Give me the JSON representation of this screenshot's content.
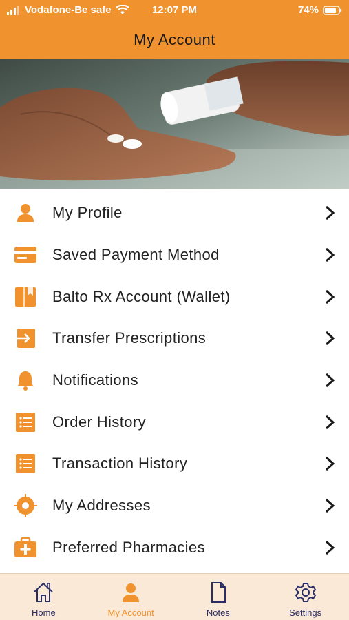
{
  "status": {
    "carrier": "Vodafone-Be safe",
    "time": "12:07 PM",
    "battery": "74%"
  },
  "header": {
    "title": "My Account"
  },
  "menu": {
    "items": [
      {
        "label": "My Profile",
        "icon": "user-icon"
      },
      {
        "label": "Saved Payment Method",
        "icon": "credit-card-icon"
      },
      {
        "label": "Balto Rx Account (Wallet)",
        "icon": "wallet-book-icon"
      },
      {
        "label": "Transfer Prescriptions",
        "icon": "transfer-arrow-icon"
      },
      {
        "label": "Notifications",
        "icon": "bell-icon"
      },
      {
        "label": "Order History",
        "icon": "list-icon"
      },
      {
        "label": "Transaction History",
        "icon": "list-icon"
      },
      {
        "label": "My Addresses",
        "icon": "location-target-icon"
      },
      {
        "label": "Preferred Pharmacies",
        "icon": "medical-kit-icon"
      }
    ]
  },
  "tabs": [
    {
      "label": "Home",
      "icon": "home-icon",
      "active": false
    },
    {
      "label": "My Account",
      "icon": "user-icon",
      "active": true
    },
    {
      "label": "Notes",
      "icon": "document-icon",
      "active": false
    },
    {
      "label": "Settings",
      "icon": "gear-icon",
      "active": false
    }
  ],
  "colors": {
    "accent": "#f0922d",
    "tab_bar_bg": "#fbe9d8",
    "tab_inactive": "#2a2e66"
  }
}
